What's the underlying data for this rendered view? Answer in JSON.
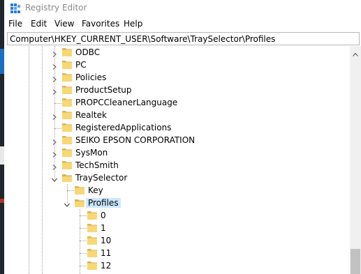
{
  "window": {
    "title": "Registry Editor",
    "icon": "registry-editor-icon"
  },
  "menu": [
    "File",
    "Edit",
    "View",
    "Favorites",
    "Help"
  ],
  "address": {
    "value": "Computer\\HKEY_CURRENT_USER\\Software\\TraySelector\\Profiles"
  },
  "tree": {
    "software_children": [
      {
        "label": "ODBC",
        "expandable": true
      },
      {
        "label": "PC",
        "expandable": true
      },
      {
        "label": "Policies",
        "expandable": true
      },
      {
        "label": "ProductSetup",
        "expandable": true
      },
      {
        "label": "PROPCCleanerLanguage",
        "expandable": false
      },
      {
        "label": "Realtek",
        "expandable": true
      },
      {
        "label": "RegisteredApplications",
        "expandable": false
      },
      {
        "label": "SEIKO EPSON CORPORATION",
        "expandable": true
      },
      {
        "label": "SysMon",
        "expandable": true
      },
      {
        "label": "TechSmith",
        "expandable": true
      },
      {
        "label": "TraySelector",
        "expandable": true,
        "expanded": true
      }
    ],
    "trayselector_children": [
      {
        "label": "Key"
      },
      {
        "label": "Profiles",
        "expanded": true,
        "selected": true
      }
    ],
    "profiles_children": [
      "0",
      "1",
      "10",
      "11",
      "12"
    ]
  },
  "colors": {
    "folder": "#f8d775",
    "folder_dark": "#dcb453",
    "selection": "#cce8ff"
  }
}
